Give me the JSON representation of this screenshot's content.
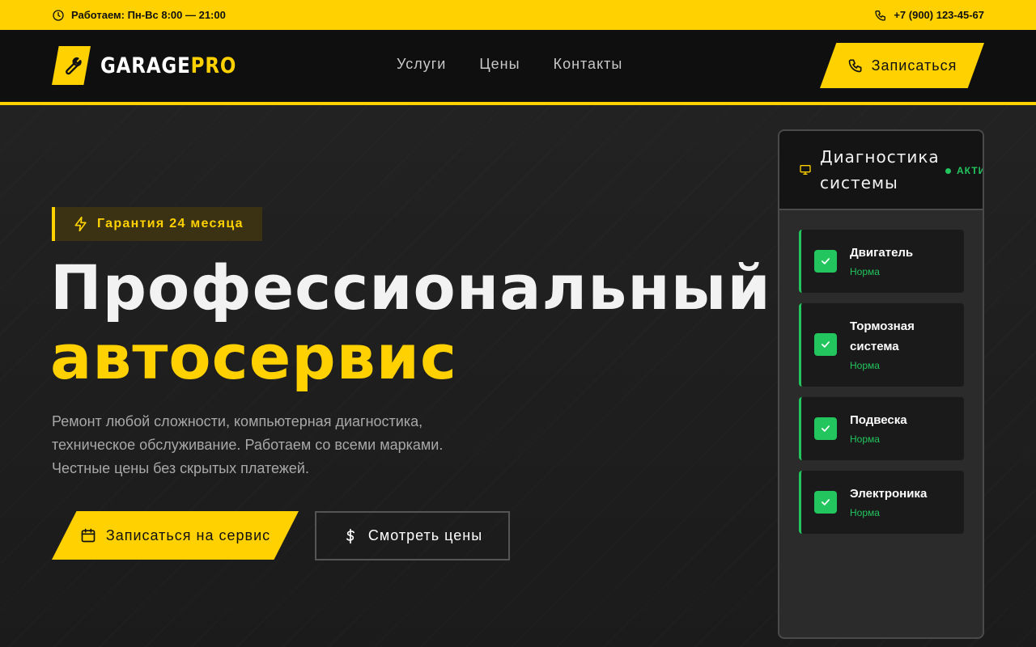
{
  "topbar": {
    "hours": "Работаем: Пн-Вс 8:00 — 21:00",
    "phone": "+7 (900) 123-45-67",
    "icons": {
      "hours": "clock-icon",
      "phone": "phone-icon"
    }
  },
  "header": {
    "logo": {
      "part1": "GARAGE",
      "part2": "PRO",
      "icon": "wrench-icon"
    },
    "nav": [
      "Услуги",
      "Цены",
      "Контакты"
    ],
    "cta": "Записаться"
  },
  "hero": {
    "badge": "Гарантия 24 месяца",
    "title_line1": "Профессиональный",
    "title_line2": "автосервис",
    "description": "Ремонт любой сложности, компьютерная диагностика, техническое обслуживание. Работаем со всеми марками. Честные цены без скрытых платежей.",
    "primary_button": "Записаться на сервис",
    "secondary_button": "Смотреть цены"
  },
  "diagnostics": {
    "title": "Диагностика системы",
    "status": "АКТИВНО",
    "items": [
      {
        "name": "Двигатель",
        "state": "Норма"
      },
      {
        "name": "Тормозная система",
        "state": "Норма"
      },
      {
        "name": "Подвеска",
        "state": "Норма"
      },
      {
        "name": "Электроника",
        "state": "Норма"
      }
    ]
  },
  "colors": {
    "accent": "#ffd100",
    "background": "#1c1c1c",
    "header": "#0f0f0f",
    "ok": "#22c55e"
  }
}
